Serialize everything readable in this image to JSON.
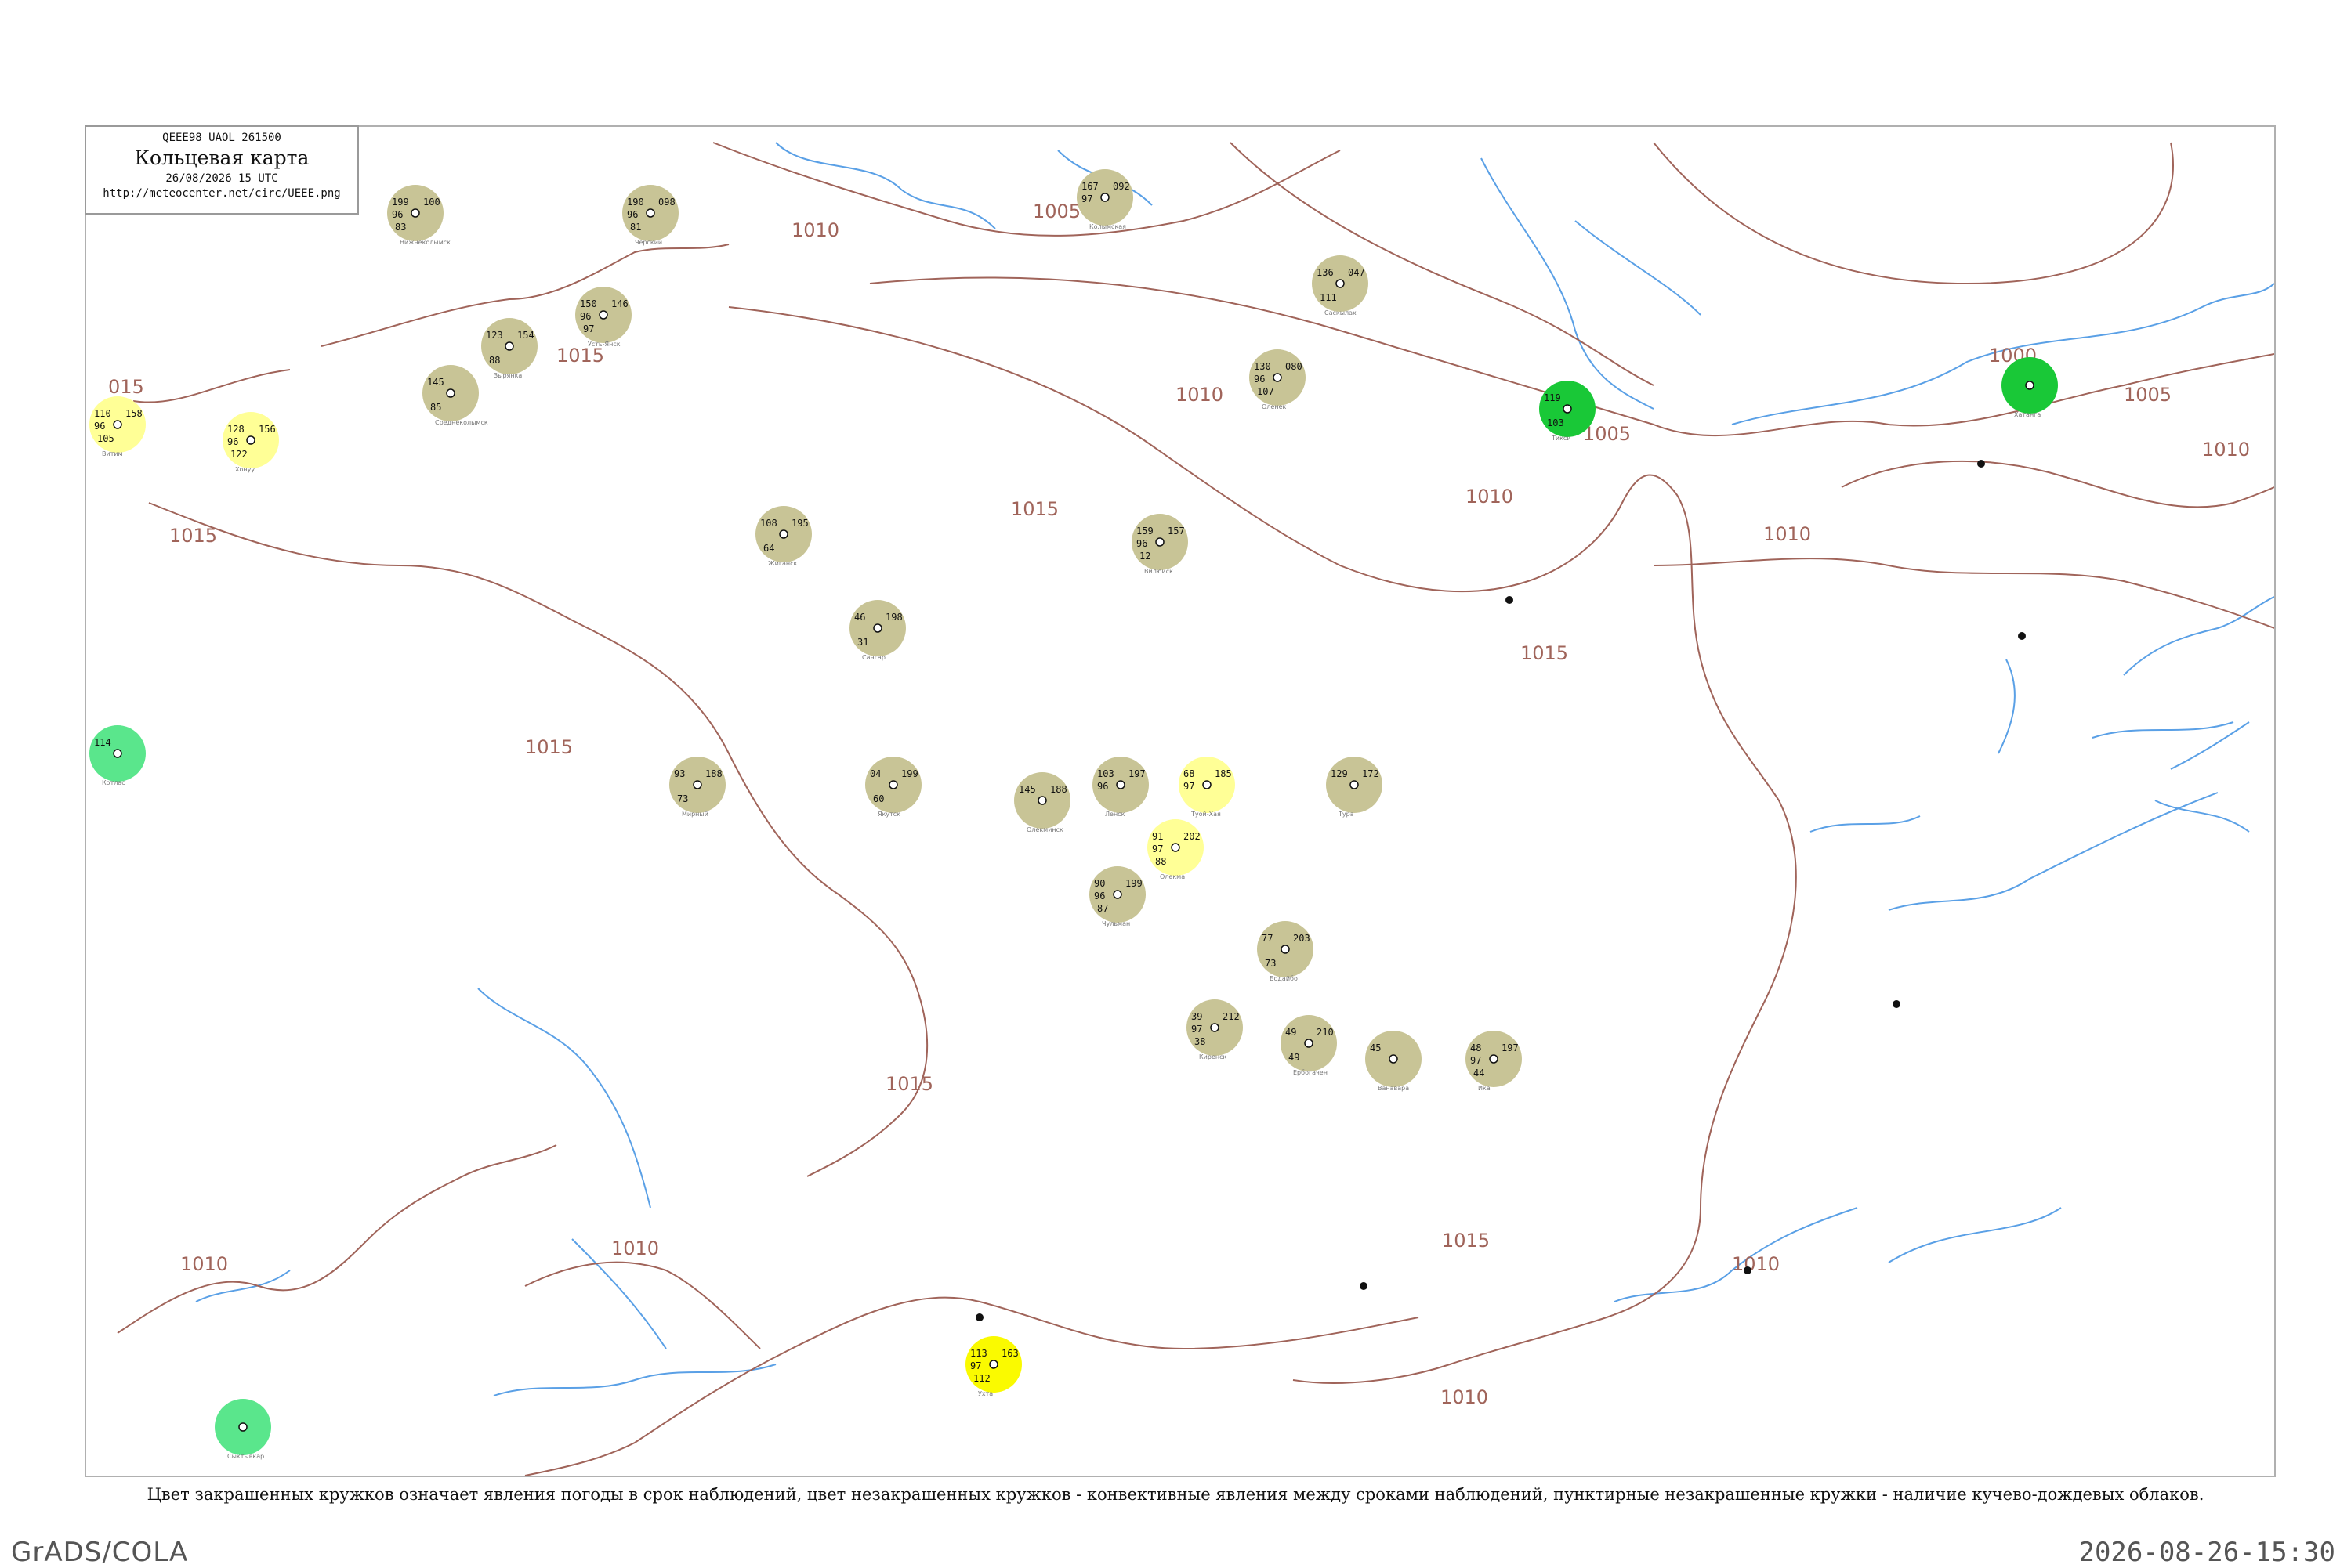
{
  "legend": {
    "code_line": "QEEE98  UAOL  261500",
    "title": "Кольцевая карта",
    "date_line": "26/08/2026 15 UTC",
    "url": "http://meteocenter.net/circ/UEEE.png"
  },
  "caption": "Цвет закрашенных кружков означает явления погоды в срок наблюдений, цвет незакрашенных кружков - конвективные явления между сроками наблюдений, пунктирные незакрашенные кружки - наличие кучево-дождевых облаков.",
  "footer": {
    "left": "GrADS/COLA",
    "right": "2026-08-26-15:30"
  },
  "colors": {
    "isobar": "#a0645a",
    "coast": "#5aa0e6",
    "drizzle_fill": "#c8c496",
    "rain_fill": "#19c837",
    "fog_fill": "#ffff96",
    "light_rain_fill": "#5ae68c",
    "cb_dashed": "#19c837",
    "storm_fill": "#fafa00"
  },
  "isobar_labels": [
    "1005",
    "1010",
    "1015",
    "1010",
    "1015",
    "1010",
    "1010",
    "1005",
    "1005",
    "1000",
    "1010",
    "1010",
    "1015",
    "1015",
    "1015",
    "1010",
    "1015",
    "1010",
    "1010",
    "015",
    "1015"
  ],
  "stations": [
    {
      "name": "Нижнеколымск",
      "p": "199",
      "t": "96",
      "d": "83",
      "v": "100",
      "fill": "drizzle"
    },
    {
      "name": "Черский",
      "p": "190",
      "t": "96",
      "d": "81",
      "v": "098",
      "fill": "drizzle"
    },
    {
      "name": "Колымская",
      "p": "167",
      "t": "97",
      "d": "",
      "v": "092",
      "fill": "drizzle"
    },
    {
      "name": "Усть-Янск",
      "p": "150",
      "t": "96",
      "d": "97",
      "v": "146",
      "fill": "drizzle"
    },
    {
      "name": "Зырянка",
      "p": "123",
      "t": "",
      "d": "88",
      "v": "154",
      "fill": "drizzle"
    },
    {
      "name": "Среднеколымск",
      "p": "145",
      "t": "",
      "d": "85",
      "v": "",
      "fill": "drizzle"
    },
    {
      "name": "Саскылах",
      "p": "136",
      "t": "",
      "d": "111",
      "v": "047",
      "fill": "drizzle"
    },
    {
      "name": "Оленек",
      "p": "130",
      "t": "96",
      "d": "107",
      "v": "080",
      "fill": "drizzle"
    },
    {
      "name": "Жиганск",
      "p": "108",
      "t": "",
      "d": "64",
      "v": "195",
      "fill": "drizzle"
    },
    {
      "name": "Сангар",
      "p": "46",
      "t": "",
      "d": "31",
      "v": "198",
      "fill": "drizzle"
    },
    {
      "name": "Вилюйск",
      "p": "159",
      "t": "96",
      "d": "12",
      "v": "157",
      "fill": "drizzle"
    },
    {
      "name": "Тикси",
      "p": "119",
      "t": "",
      "d": "103",
      "v": "",
      "fill": "rain"
    },
    {
      "name": "Хатанга",
      "p": "",
      "t": "",
      "d": "",
      "v": "",
      "fill": "rain"
    },
    {
      "name": "Мирный",
      "p": "93",
      "t": "",
      "d": "73",
      "v": "188",
      "fill": "drizzle"
    },
    {
      "name": "Якутск",
      "p": "04",
      "t": "",
      "d": "60",
      "v": "199",
      "fill": "drizzle"
    },
    {
      "name": "Олекминск",
      "p": "145",
      "t": "",
      "d": "",
      "v": "188",
      "fill": "drizzle"
    },
    {
      "name": "Ленск",
      "p": "103",
      "t": "96",
      "d": "",
      "v": "197",
      "fill": "drizzle"
    },
    {
      "name": "Чульман",
      "p": "90",
      "t": "96",
      "d": "87",
      "v": "199",
      "fill": "drizzle"
    },
    {
      "name": "Тура",
      "p": "129",
      "t": "",
      "d": "",
      "v": "172",
      "fill": "drizzle"
    },
    {
      "name": "Бодайбо",
      "p": "77",
      "t": "",
      "d": "73",
      "v": "203",
      "fill": "drizzle"
    },
    {
      "name": "Киренск",
      "p": "39",
      "t": "97",
      "d": "38",
      "v": "212",
      "fill": "drizzle"
    },
    {
      "name": "Ербогачен",
      "p": "49",
      "t": "",
      "d": "49",
      "v": "210",
      "fill": "drizzle"
    },
    {
      "name": "Ванавара",
      "p": "45",
      "t": "",
      "d": "",
      "v": "",
      "fill": "drizzle"
    },
    {
      "name": "Ика",
      "p": "48",
      "t": "97",
      "d": "44",
      "v": "197",
      "fill": "drizzle"
    },
    {
      "name": "Туой-Хая",
      "p": "68",
      "t": "97",
      "d": "",
      "v": "185",
      "fill": "fog"
    },
    {
      "name": "Олекма",
      "p": "91",
      "t": "97",
      "d": "88",
      "v": "202",
      "fill": "fog"
    },
    {
      "name": "Витим",
      "p": "110",
      "t": "96",
      "d": "105",
      "v": "158",
      "fill": "fog"
    },
    {
      "name": "Хонуу",
      "p": "128",
      "t": "96",
      "d": "122",
      "v": "156",
      "fill": "fog"
    },
    {
      "name": "Ухта",
      "p": "113",
      "t": "97",
      "d": "112",
      "v": "163",
      "fill": "storm"
    },
    {
      "name": "Сыктывкар",
      "p": "",
      "t": "",
      "d": "",
      "v": "",
      "fill": "light_rain"
    },
    {
      "name": "Котлас",
      "p": "114",
      "t": "",
      "d": "",
      "v": "",
      "fill": "light_rain"
    }
  ]
}
